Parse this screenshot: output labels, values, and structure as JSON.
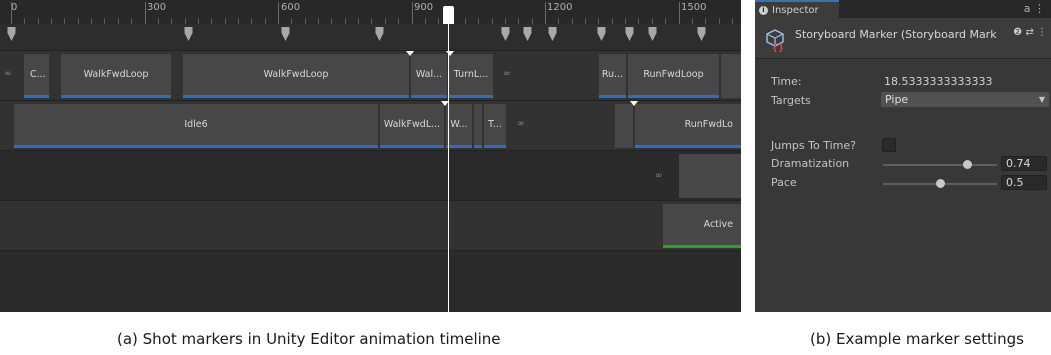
{
  "timeline": {
    "ruler_labels": [
      "0",
      "300",
      "600",
      "900",
      "1200",
      "1500"
    ],
    "tracks": [
      {
        "clips": [
          {
            "label": "C..."
          },
          {
            "label": "WalkFwdLoop"
          },
          {
            "label": "WalkFwdLoop"
          },
          {
            "label": "Wal..."
          },
          {
            "label": "TurnL..."
          },
          {
            "label": "Ru..."
          },
          {
            "label": "RunFwdLoop"
          }
        ]
      },
      {
        "clips": [
          {
            "label": "Idle6"
          },
          {
            "label": "WalkFwdL..."
          },
          {
            "label": "W..."
          },
          {
            "label": "T..."
          },
          {
            "label": "RunFwdLo"
          }
        ]
      },
      {
        "clips": [
          {
            "label": "Active"
          }
        ]
      }
    ],
    "loop_symbol": "∞"
  },
  "inspector": {
    "tab_label": "Inspector",
    "tab_tools": "a ⋮",
    "title": "Storyboard Marker (Storyboard Mark",
    "title_icons": "❷ ⇄ ⋮",
    "properties": {
      "time_label": "Time:",
      "time_value": "18.5333333333333",
      "targets_label": "Targets",
      "targets_value": "Pipe",
      "jumps_label": "Jumps To Time?",
      "dramatization_label": "Dramatization",
      "dramatization_value": "0.74",
      "dramatization_level": 0.74,
      "pace_label": "Pace",
      "pace_value": "0.5",
      "pace_level": 0.5
    }
  },
  "captions": {
    "left": "(a) Shot markers in Unity Editor animation timeline",
    "right": "(b) Example marker settings"
  },
  "colors": {
    "clip_bar": "#2f6dbd",
    "active_bar": "#2aa02a",
    "playhead": "#ffffff"
  },
  "icons": [
    "marker-icon",
    "loop-icon",
    "info-icon",
    "storyboard-marker-icon",
    "help-icon",
    "preset-icon",
    "menu-icon",
    "dropdown-arrow-icon"
  ]
}
